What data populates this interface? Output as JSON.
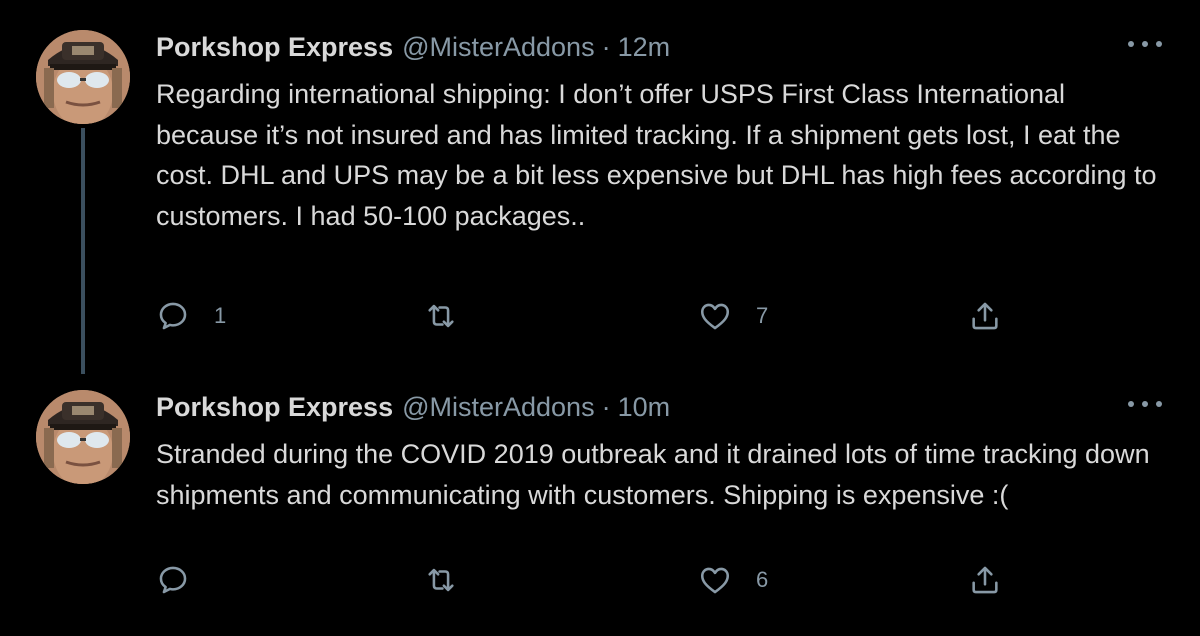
{
  "colors": {
    "background": "#000000",
    "text": "#d9d9d9",
    "secondary": "#8899a6",
    "thread_line": "#3b4f5e"
  },
  "tweets": [
    {
      "author_name": "Porkshop Express",
      "handle": "@MisterAddons",
      "separator": "·",
      "time": "12m",
      "text": "Regarding international shipping: I don’t offer USPS First Class International because it’s not insured and has limited tracking. If a shipment gets lost, I eat the cost. DHL and UPS may be a bit less expensive but DHL has high fees according to customers. I had 50-100 packages..",
      "reply_count": "1",
      "retweet_count": "",
      "like_count": "7"
    },
    {
      "author_name": "Porkshop Express",
      "handle": "@MisterAddons",
      "separator": "·",
      "time": "10m",
      "text": "Stranded during the COVID 2019 outbreak and it drained lots of time tracking down shipments and communicating with customers. Shipping is expensive :(",
      "reply_count": "",
      "retweet_count": "",
      "like_count": "6"
    }
  ],
  "icons": {
    "reply": "reply-icon",
    "retweet": "retweet-icon",
    "like": "heart-icon",
    "share": "share-icon",
    "more": "more-icon"
  }
}
